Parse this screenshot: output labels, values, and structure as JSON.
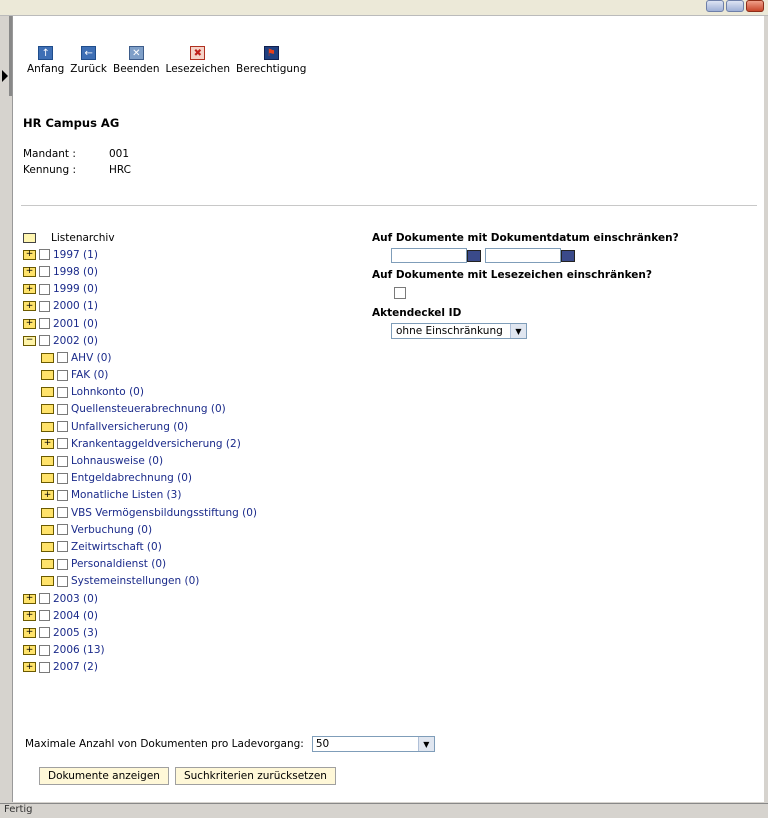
{
  "toolbar": {
    "items": [
      {
        "label": "Anfang",
        "icon": "home-icon"
      },
      {
        "label": "Zurück",
        "icon": "back-icon"
      },
      {
        "label": "Beenden",
        "icon": "close-icon"
      },
      {
        "label": "Lesezeichen",
        "icon": "bookmark-icon"
      },
      {
        "label": "Berechtigung",
        "icon": "permission-icon"
      }
    ]
  },
  "company": {
    "name": "HR Campus AG",
    "mandant_label": "Mandant :",
    "mandant_value": "001",
    "kennung_label": "Kennung :",
    "kennung_value": "HRC"
  },
  "tree": {
    "root_label": "Listenarchiv",
    "years_before": [
      "1997 (1)",
      "1998 (0)",
      "1999 (0)",
      "2000 (1)",
      "2001 (0)"
    ],
    "open_year": "2002 (0)",
    "children": [
      {
        "label": "AHV (0)",
        "expandable": false
      },
      {
        "label": "FAK (0)",
        "expandable": false
      },
      {
        "label": "Lohnkonto (0)",
        "expandable": false
      },
      {
        "label": "Quellensteuerabrechnung (0)",
        "expandable": false
      },
      {
        "label": "Unfallversicherung (0)",
        "expandable": false
      },
      {
        "label": "Krankentaggeldversicherung (2)",
        "expandable": true
      },
      {
        "label": "Lohnausweise (0)",
        "expandable": false
      },
      {
        "label": "Entgeldabrechnung (0)",
        "expandable": false
      },
      {
        "label": "Monatliche Listen (3)",
        "expandable": true
      },
      {
        "label": "VBS Vermögensbildungsstiftung (0)",
        "expandable": false
      },
      {
        "label": "Verbuchung (0)",
        "expandable": false
      },
      {
        "label": "Zeitwirtschaft (0)",
        "expandable": false
      },
      {
        "label": "Personaldienst (0)",
        "expandable": false
      },
      {
        "label": "Systemeinstellungen (0)",
        "expandable": false
      }
    ],
    "years_after": [
      "2003 (0)",
      "2004 (0)",
      "2005 (3)",
      "2006 (13)",
      "2007 (2)"
    ]
  },
  "filters": {
    "date_heading": "Auf Dokumente mit Dokumentdatum einschränken?",
    "bookmark_heading": "Auf Dokumente mit Lesezeichen einschränken?",
    "folder_id_heading": "Aktendeckel ID",
    "folder_id_value": "ohne Einschränkung"
  },
  "max_docs": {
    "label": "Maximale Anzahl von Dokumenten pro Ladevorgang:",
    "value": "50"
  },
  "buttons": {
    "show": "Dokumente anzeigen",
    "reset": "Suchkriterien zurücksetzen"
  },
  "status": {
    "text": "Fertig"
  }
}
